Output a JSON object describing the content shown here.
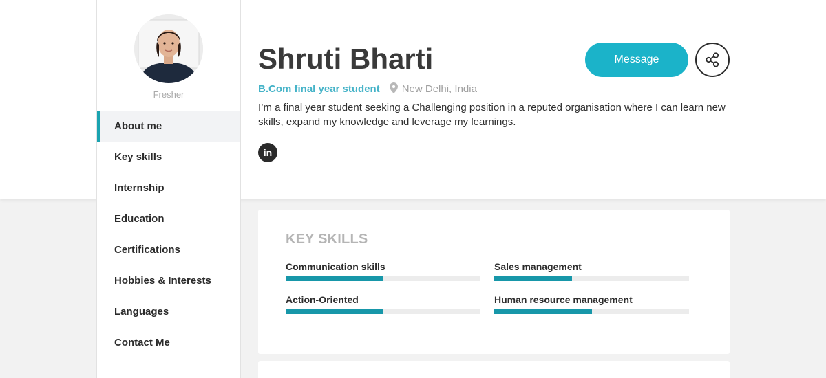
{
  "profile": {
    "name": "Shruti Bharti",
    "role": "B.Com final year student",
    "location": "New Delhi, India",
    "bio": "I’m a final year student seeking a Challenging position in a reputed organisation where I can learn new skills, expand my knowledge and leverage my learnings.",
    "status": "Fresher",
    "linkedin_icon_text": "in"
  },
  "actions": {
    "message_label": "Message",
    "share_icon": "share-icon"
  },
  "sidebar": {
    "items": [
      {
        "label": "About me",
        "active": true
      },
      {
        "label": "Key skills",
        "active": false
      },
      {
        "label": "Internship",
        "active": false
      },
      {
        "label": "Education",
        "active": false
      },
      {
        "label": "Certifications",
        "active": false
      },
      {
        "label": "Hobbies & Interests",
        "active": false
      },
      {
        "label": "Languages",
        "active": false
      },
      {
        "label": "Contact Me",
        "active": false
      }
    ]
  },
  "key_skills": {
    "title": "KEY SKILLS",
    "skills": [
      {
        "name": "Communication skills",
        "level": 0.5
      },
      {
        "name": "Sales management",
        "level": 0.4
      },
      {
        "name": "Action-Oriented",
        "level": 0.5
      },
      {
        "name": "Human resource management",
        "level": 0.5
      }
    ]
  },
  "colors": {
    "accent": "#1bb3c9",
    "role_text": "#45b3c8",
    "skill_bar": "#1797a9",
    "active_marker": "#1aa3b0"
  }
}
